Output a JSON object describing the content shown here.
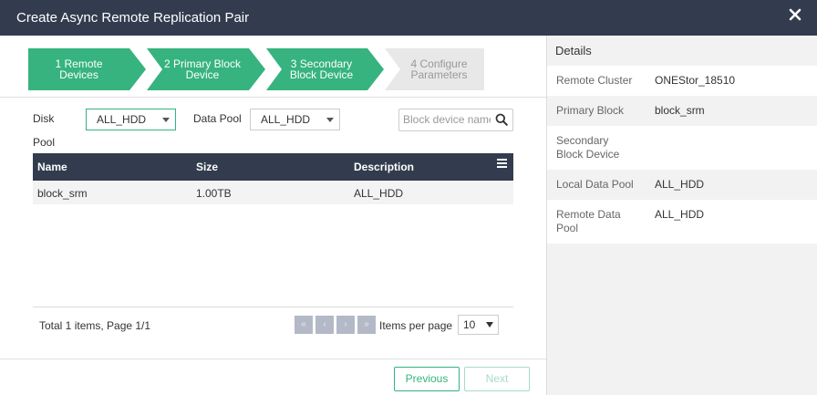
{
  "dialog": {
    "title": "Create Async Remote Replication Pair"
  },
  "wizard": {
    "steps": [
      {
        "line1": "1 Remote",
        "line2": "Devices",
        "state": "done"
      },
      {
        "line1": "2 Primary Block",
        "line2": "Device",
        "state": "done"
      },
      {
        "line1": "3 Secondary",
        "line2": "Block Device",
        "state": "done"
      },
      {
        "line1": "4 Configure",
        "line2": "Parameters",
        "state": "todo"
      }
    ]
  },
  "filters": {
    "disk_pool_label_1": "Disk",
    "disk_pool_label_2": "Pool",
    "disk_pool_value": "ALL_HDD",
    "data_pool_label": "Data Pool",
    "data_pool_value": "ALL_HDD",
    "search_placeholder": "Block device name"
  },
  "table": {
    "columns": [
      "Name",
      "Size",
      "Description"
    ],
    "rows": [
      {
        "name": "block_srm",
        "size": "1.00TB",
        "description": "ALL_HDD"
      }
    ]
  },
  "pagination": {
    "summary": "Total 1 items, Page 1/1",
    "first": "«",
    "prev": "‹",
    "next": "›",
    "last": "»",
    "items_per_page_label": "Items per page",
    "items_per_page": "10"
  },
  "buttons": {
    "previous": "Previous",
    "next": "Next"
  },
  "details": {
    "heading": "Details",
    "rows": [
      {
        "key1": "Remote Cluster",
        "key2": "",
        "value": "ONEStor_18510"
      },
      {
        "key1": "Primary Block",
        "key2": "",
        "value": "block_srm"
      },
      {
        "key1": "Secondary",
        "key2": "Block Device",
        "value": ""
      },
      {
        "key1": "Local Data Pool",
        "key2": "",
        "value": "ALL_HDD"
      },
      {
        "key1": "Remote Data",
        "key2": "Pool",
        "value": "ALL_HDD"
      }
    ]
  },
  "colors": {
    "header_bg": "#333c4e",
    "accent": "#36b37e",
    "pending_step": "#e8e8e8"
  }
}
